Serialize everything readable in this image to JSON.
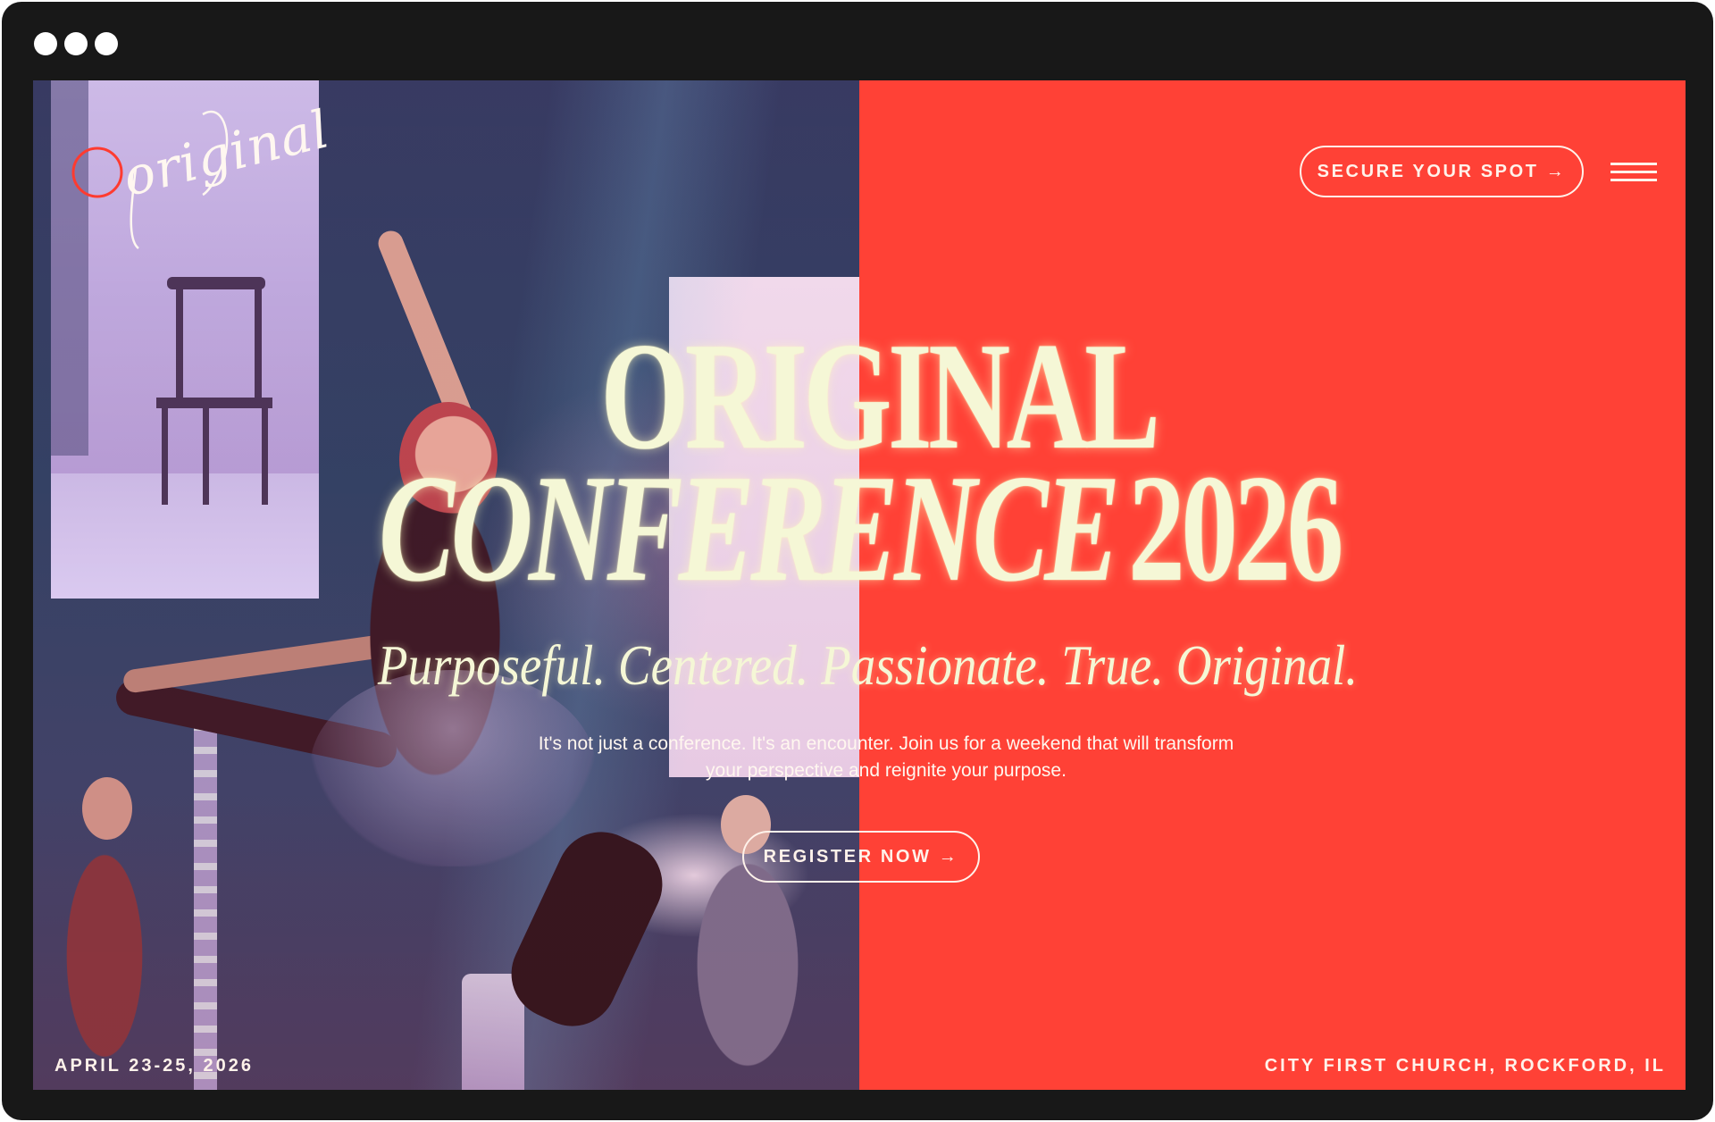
{
  "window": {
    "dot_color": "#ffffff",
    "frame_color": "#181818"
  },
  "brand": {
    "logo_text": "original",
    "logo_circle_color": "#ff3b30",
    "accent_color": "#ff4136"
  },
  "header": {
    "cta_label": "SECURE YOUR SPOT →",
    "menu_icon": "hamburger-menu-icon"
  },
  "hero": {
    "title_line1": "ORIGINAL",
    "title_line2_italic": "CONFERENCE",
    "title_line2_year": "2026",
    "tagline": "Purposeful. Centered. Passionate. True. Original.",
    "description": "It's not just a conference. It's an encounter. Join us for a weekend that will transform your perspective and reignite your purpose.",
    "cta_label": "REGISTER NOW →",
    "title_color": "#f5f7d6"
  },
  "footer": {
    "date": "APRIL 23-25, 2026",
    "venue": "CITY FIRST CHURCH, ROCKFORD, IL"
  }
}
